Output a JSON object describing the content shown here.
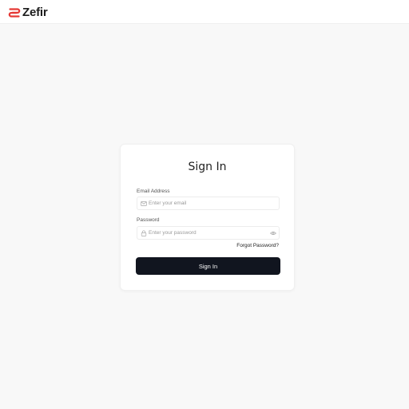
{
  "header": {
    "brand_name": "Zefir",
    "logo_icon": "zefir-logo",
    "logo_color": "#e53935"
  },
  "signin_form": {
    "title": "Sign In",
    "email": {
      "label": "Email Address",
      "placeholder": "Enter your email",
      "value": "",
      "icon": "mail-icon"
    },
    "password": {
      "label": "Password",
      "placeholder": "Enter your password",
      "value": "",
      "icon": "lock-icon",
      "toggle_icon": "eye-icon"
    },
    "forgot_password": "Forgot Password?",
    "submit_label": "Sign In",
    "submit_color": "#11151f"
  }
}
